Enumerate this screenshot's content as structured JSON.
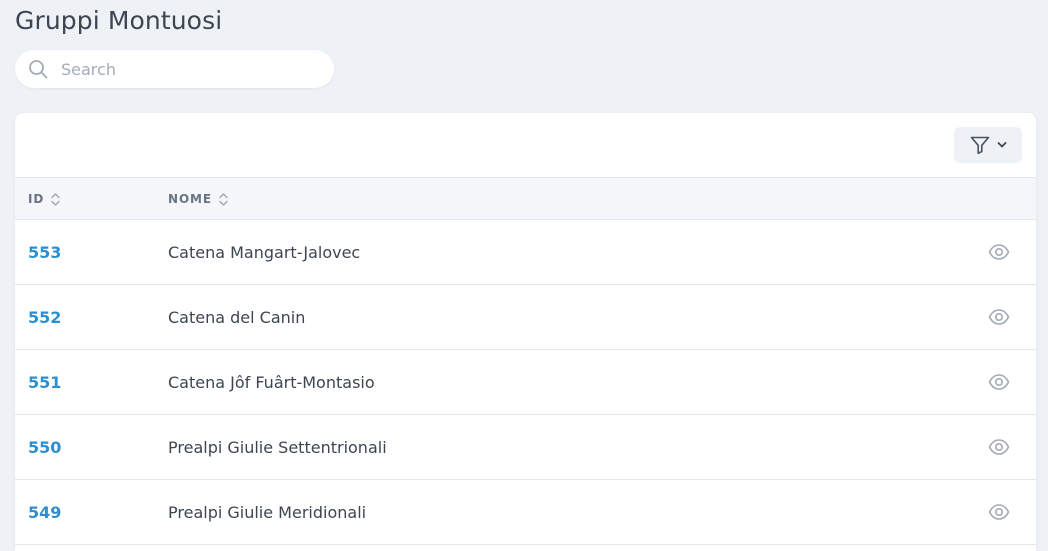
{
  "page": {
    "title": "Gruppi Montuosi"
  },
  "search": {
    "placeholder": "Search",
    "value": ""
  },
  "toolbar": {
    "filter_icon": "funnel-icon",
    "filter_dropdown_icon": "chevron-down-icon"
  },
  "table": {
    "columns": [
      {
        "label": "ID",
        "sortable": true
      },
      {
        "label": "Nome",
        "sortable": true
      }
    ],
    "rows": [
      {
        "id": "553",
        "nome": "Catena Mangart-Jalovec"
      },
      {
        "id": "552",
        "nome": "Catena del Canin"
      },
      {
        "id": "551",
        "nome": "Catena Jôf Fuârt-Montasio"
      },
      {
        "id": "550",
        "nome": "Prealpi Giulie Settentrionali"
      },
      {
        "id": "549",
        "nome": "Prealpi Giulie Meridionali"
      }
    ],
    "row_action_icon": "eye-icon"
  },
  "colors": {
    "background": "#eef1f6",
    "link": "#2c8fd1",
    "text": "#3d4552",
    "muted": "#a3abb8"
  }
}
